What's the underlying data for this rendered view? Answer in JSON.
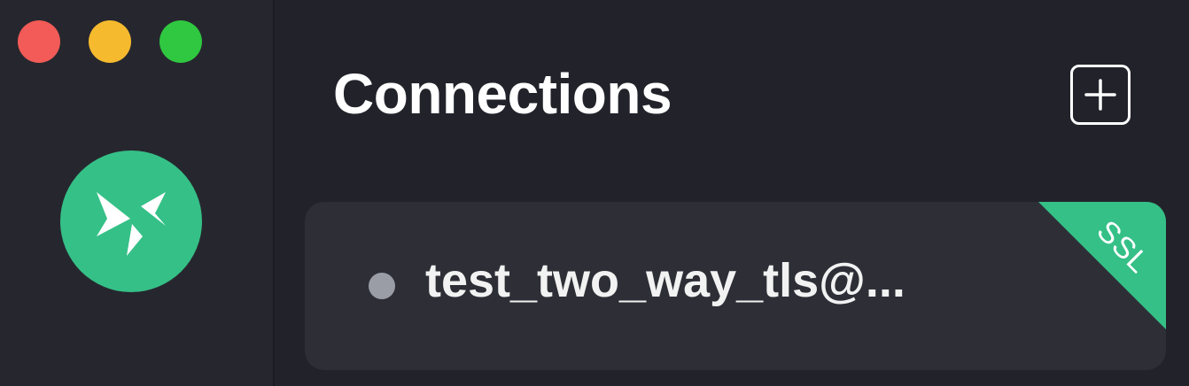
{
  "window": {
    "traffic_lights": {
      "close_color": "#f25b57",
      "minimize_color": "#f6ba2f",
      "maximize_color": "#2fc840"
    }
  },
  "sidebar": {
    "logo_icon": "mqttx-logo-icon",
    "logo_color": "#35c087"
  },
  "header": {
    "title": "Connections",
    "add_icon": "plus-icon"
  },
  "connections": [
    {
      "name": "test_two_way_tls@...",
      "status_color": "#9a9ca6",
      "badge": "SSL",
      "badge_color": "#35c087"
    }
  ]
}
